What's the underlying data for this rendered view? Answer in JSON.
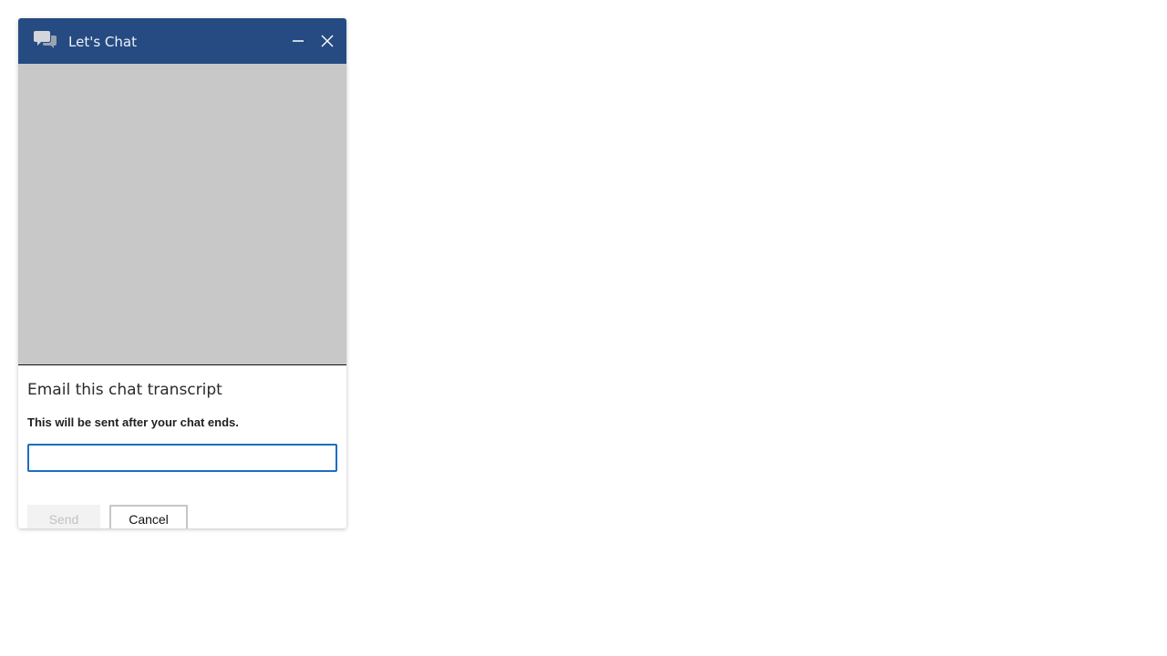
{
  "window": {
    "title": "Let's Chat",
    "icons": {
      "app": "chat-bubbles-icon",
      "minimize": "minimize-icon",
      "close": "close-icon"
    },
    "colors": {
      "header_bg": "#264b82",
      "messages_bg": "#c8c8c8",
      "input_focus_border": "#1a6fc4"
    }
  },
  "email_transcript": {
    "heading": "Email this chat transcript",
    "note": "This will be sent after your chat ends.",
    "email_value": "",
    "send_label": "Send",
    "cancel_label": "Cancel"
  }
}
